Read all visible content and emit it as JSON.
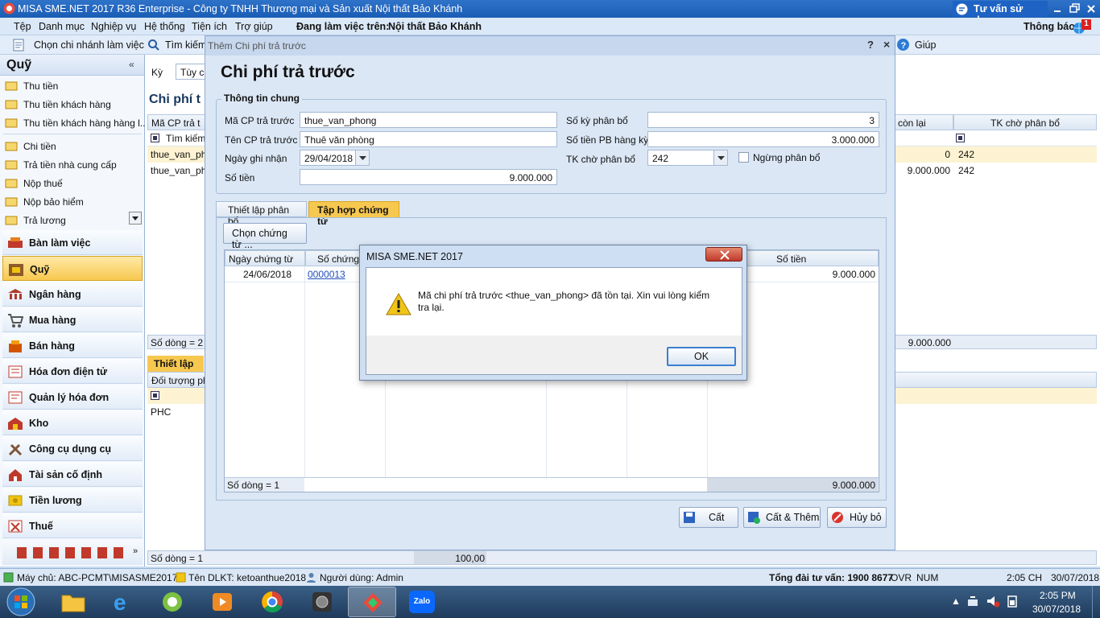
{
  "app": {
    "title": "MISA SME.NET 2017 R36 Enterprise - Công ty TNHH Thương mại và Sản xuất Nội thất Bảo Khánh",
    "consult_label": "Tư vấn sử dụng",
    "notify_label": "Thông báo",
    "notify_count": "1"
  },
  "menu": {
    "items": [
      "Tệp",
      "Danh mục",
      "Nghiệp vụ",
      "Hệ thống",
      "Tiện ích",
      "Trợ giúp"
    ],
    "working_on": "Đang làm việc trên:",
    "company": "Nội thất Bảo Khánh"
  },
  "toolbar": {
    "branch_label": "Chọn chi nhánh làm việc",
    "search_label": "Tìm kiếm",
    "help_label": "Giúp"
  },
  "left_panel": {
    "title": "Quỹ",
    "items": [
      "Thu tiền",
      "Thu tiền khách hàng",
      "Thu tiền khách hàng hàng l...",
      "Chi tiền",
      "Trả tiền nhà cung cấp",
      "Nộp thuế",
      "Nộp bảo hiểm",
      "Trả lương"
    ],
    "modules": [
      "Bàn làm việc",
      "Quỹ",
      "Ngân hàng",
      "Mua hàng",
      "Bán hàng",
      "Hóa đơn điện tử",
      "Quản lý hóa đơn",
      "Kho",
      "Công cụ dụng cụ",
      "Tài sản cố định",
      "Tiền lương",
      "Thuế"
    ]
  },
  "background": {
    "period_label": "Kỳ",
    "period_value": "Tùy ch",
    "section_title": "Chi phí t",
    "col_code": "Mã CP trả t",
    "col_remaining": "còn lại",
    "col_account": "TK chờ phân bổ",
    "search_row": "Tìm kiếm",
    "rows": [
      {
        "code": "thue_van_pho",
        "remaining": "0",
        "account": "242"
      },
      {
        "code": "thue_van_ph",
        "remaining": "9.000.000",
        "account": "242"
      }
    ],
    "row_count": "Số dòng = 2",
    "total": "9.000.000",
    "tab_setup": "Thiết lập p",
    "col_object": "Đối tượng ph",
    "object_row": "PHC",
    "bottom_row_count": "Số dòng = 1",
    "bottom_total": "100,00"
  },
  "dialog": {
    "window_title": "Thêm Chi phí trả trước",
    "heading": "Chi phí trả trước",
    "group_title": "Thông tin chung",
    "fields": {
      "code_label": "Mã CP trả trước",
      "code_value": "thue_van_phong",
      "name_label": "Tên CP trả trước",
      "name_value": "Thuê văn phòng",
      "date_label": "Ngày ghi nhận",
      "date_value": "29/04/2018",
      "amount_label": "Số tiền",
      "amount_value": "9.000.000",
      "periods_label": "Số kỳ phân bổ",
      "periods_value": "3",
      "per_period_label": "Số tiền PB hàng kỳ",
      "per_period_value": "3.000.000",
      "account_label": "TK chờ phân bổ",
      "account_value": "242",
      "stop_label": "Ngừng phân bổ"
    },
    "tabs": [
      "Thiết lập phân bổ",
      "Tập hợp chứng từ"
    ],
    "choose_docs_label": "Chọn chứng từ ...",
    "grid": {
      "col_date": "Ngày chứng từ",
      "col_docno": "Số chứng từ",
      "col_amount": "Số tiền",
      "rows": [
        {
          "date": "24/06/2018",
          "docno": "0000013",
          "amount": "9.000.000"
        }
      ],
      "row_count": "Số dòng = 1",
      "total": "9.000.000"
    },
    "buttons": {
      "save": "Cất",
      "save_add": "Cất & Thêm",
      "cancel": "Hủy bỏ"
    }
  },
  "msgbox": {
    "title": "MISA SME.NET 2017",
    "text": "Mã chi phí trả trước <thue_van_phong> đã tồn tại. Xin vui lòng kiểm tra lại.",
    "ok_label": "OK"
  },
  "statusbar": {
    "server": "Máy chủ: ABC-PCMT\\MISASME2017",
    "db": "Tên DLKT: ketoanthue2018",
    "user": "Người dùng: Admin",
    "hotline": "Tổng đài tư vấn: 1900 8677",
    "ovr": "OVR",
    "num": "NUM",
    "time": "2:05 CH",
    "date": "30/07/2018"
  },
  "taskbar": {
    "clock_time": "2:05 PM",
    "clock_date": "30/07/2018",
    "zalo_label": "Zalo"
  },
  "colors": {
    "accent": "#1a5db5",
    "warn": "#f0c419",
    "close": "#c0392b"
  }
}
